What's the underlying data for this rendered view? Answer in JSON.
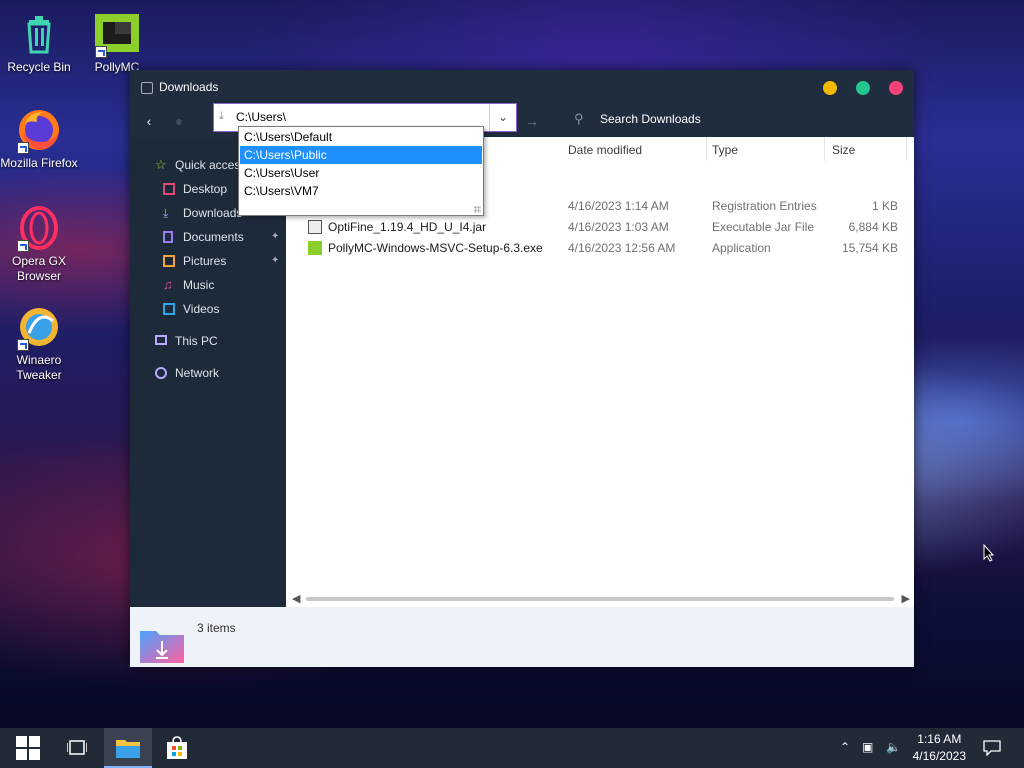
{
  "desktop": {
    "icons": [
      {
        "label": "Recycle Bin",
        "icon": "recycle-bin-icon"
      },
      {
        "label": "PollyMC",
        "icon": "pollymc-icon"
      },
      {
        "label": "Mozilla Firefox",
        "icon": "firefox-icon"
      },
      {
        "label": "Opera GX Browser",
        "icon": "opera-gx-icon"
      },
      {
        "label": "Winaero Tweaker",
        "icon": "winaero-tweaker-icon"
      }
    ]
  },
  "window": {
    "title": "Downloads",
    "controls": {
      "minimize_color": "#f5b800",
      "maximize_color": "#23c48e",
      "close_color": "#f0417a"
    },
    "address": {
      "value": "C:\\Users\\"
    },
    "search": {
      "placeholder": "Search Downloads"
    },
    "suggestions": {
      "items": [
        "C:\\Users\\Default",
        "C:\\Users\\Public",
        "C:\\Users\\User",
        "C:\\Users\\VM7"
      ],
      "selected_index": 1
    },
    "sidebar": {
      "quick_access": "Quick access",
      "items": [
        {
          "label": "Desktop",
          "icon": "desktop-icon",
          "color": "#e04a72"
        },
        {
          "label": "Downloads",
          "icon": "download-icon",
          "color": "#b9a6ff"
        },
        {
          "label": "Documents",
          "icon": "documents-icon",
          "color": "#9a7df0",
          "pinned": true
        },
        {
          "label": "Pictures",
          "icon": "pictures-icon",
          "color": "#f2a33a",
          "pinned": true
        },
        {
          "label": "Music",
          "icon": "music-icon",
          "color": "#e04a9c"
        },
        {
          "label": "Videos",
          "icon": "videos-icon",
          "color": "#2aa7e8"
        }
      ],
      "this_pc": "This PC",
      "network": "Network"
    },
    "columns": {
      "date": "Date modified",
      "type": "Type",
      "size": "Size"
    },
    "files": [
      {
        "name": "",
        "date": "4/16/2023 1:14 AM",
        "type": "Registration Entries",
        "size": "1 KB",
        "icon": "registry-file-icon"
      },
      {
        "name": "OptiFine_1.19.4_HD_U_I4.jar",
        "date": "4/16/2023 1:03 AM",
        "type": "Executable Jar File",
        "size": "6,884 KB",
        "icon": "jar-file-icon"
      },
      {
        "name": "PollyMC-Windows-MSVC-Setup-6.3.exe",
        "date": "4/16/2023 12:56 AM",
        "type": "Application",
        "size": "15,754 KB",
        "icon": "pollymc-setup-icon"
      }
    ],
    "status": {
      "count": "3 items"
    }
  },
  "taskbar": {
    "time": "1:16 AM",
    "date": "4/16/2023",
    "accent": "#7fb3f5"
  }
}
